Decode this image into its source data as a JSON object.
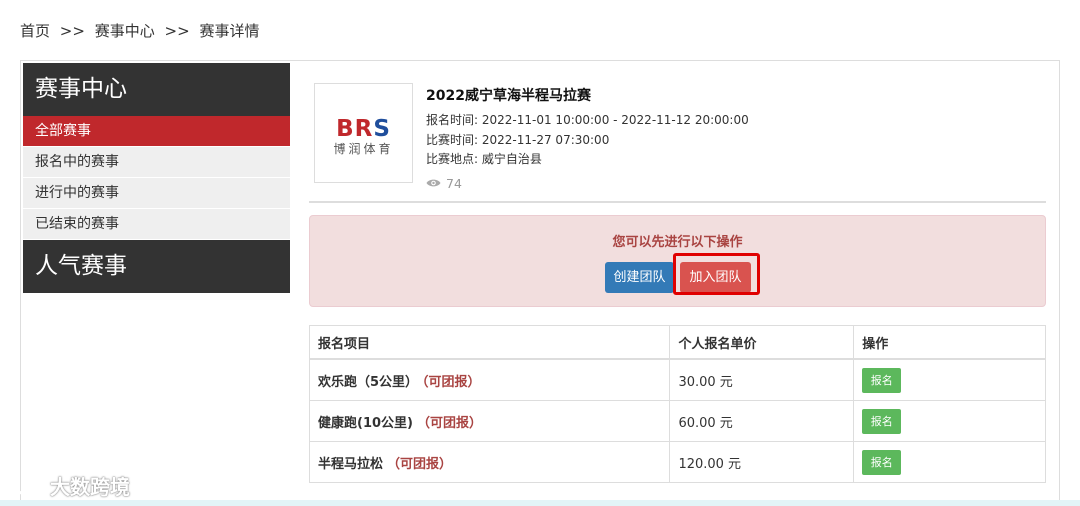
{
  "breadcrumb": {
    "home": "首页",
    "sep1": ">>",
    "center": "赛事中心",
    "sep2": ">>",
    "detail": "赛事详情"
  },
  "sidebar": {
    "heading1": "赛事中心",
    "items": [
      {
        "label": "全部赛事",
        "active": true
      },
      {
        "label": "报名中的赛事"
      },
      {
        "label": "进行中的赛事"
      },
      {
        "label": "已结束的赛事"
      }
    ],
    "heading2": "人气赛事"
  },
  "event": {
    "logo_main_1": "BR",
    "logo_main_2": "S",
    "logo_sub": "博润体育",
    "title": "2022威宁草海半程马拉赛",
    "signup_label": "报名时间:",
    "signup_time": "2022-11-01 10:00:00 - 2022-11-12 20:00:00",
    "race_label": "比赛时间:",
    "race_time": "2022-11-27 07:30:00",
    "place_label": "比赛地点:",
    "place": "威宁自治县",
    "views": "74",
    "views_icon": "eye-icon"
  },
  "alert": {
    "text": "您可以先进行以下操作",
    "create_team": "创建团队",
    "join_team": "加入团队"
  },
  "table": {
    "headers": [
      "报名项目",
      "个人报名单价",
      "操作"
    ],
    "rows": [
      {
        "project": "欢乐跑（5公里）",
        "team": "（可团报）",
        "price": "30.00 元",
        "action": "报名"
      },
      {
        "project": "健康跑(10公里)",
        "team": "（可团报）",
        "price": "60.00 元",
        "action": "报名"
      },
      {
        "project": "半程马拉松",
        "team": "（可团报）",
        "price": "120.00 元",
        "action": "报名"
      }
    ]
  },
  "watermark": "大数跨境",
  "colors": {
    "sidebar_dark": "#333333",
    "active_red": "#c0282c",
    "alert_bg": "#f2dede",
    "primary_blue": "#337ab7",
    "danger_red": "#d9534f",
    "success_green": "#5cb85c",
    "highlight_red": "#e00000"
  }
}
